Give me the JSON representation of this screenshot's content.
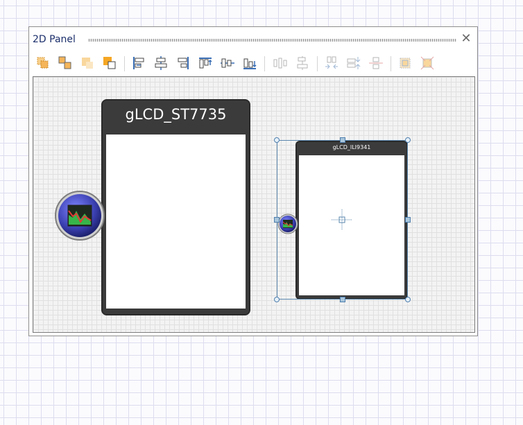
{
  "panel": {
    "title": "2D Panel",
    "close_symbol": "✕"
  },
  "toolbar": {
    "buttons": [
      {
        "name": "group-objects-icon",
        "enabled": true
      },
      {
        "name": "ungroup-objects-icon",
        "enabled": true
      },
      {
        "name": "send-backward-icon",
        "enabled": true
      },
      {
        "name": "bring-forward-icon",
        "enabled": true
      },
      {
        "name": "align-left-icon",
        "enabled": true
      },
      {
        "name": "align-center-icon",
        "enabled": true
      },
      {
        "name": "align-right-icon",
        "enabled": true
      },
      {
        "name": "align-top-icon",
        "enabled": true
      },
      {
        "name": "align-middle-icon",
        "enabled": true
      },
      {
        "name": "align-bottom-icon",
        "enabled": true
      },
      {
        "name": "distribute-horizontal-icon",
        "enabled": false
      },
      {
        "name": "distribute-vertical-icon",
        "enabled": false
      },
      {
        "name": "make-same-width-icon",
        "enabled": false
      },
      {
        "name": "make-same-height-icon",
        "enabled": false
      },
      {
        "name": "make-same-size-icon",
        "enabled": false
      },
      {
        "name": "fit-to-content-icon",
        "enabled": false
      },
      {
        "name": "reset-size-icon",
        "enabled": false
      }
    ]
  },
  "canvas": {
    "components": [
      {
        "title": "gLCD_ST7735",
        "icon": "chart-component-icon"
      },
      {
        "title": "gLCD_ILI9341",
        "icon": "chart-component-icon",
        "selected": true
      }
    ]
  },
  "colors": {
    "lcd_body": "#3b3b3b",
    "selection": "#5a86ad",
    "icon_orange": "#f5a623",
    "icon_blue": "#3b6fb6",
    "component_orb": "#3a3fb0"
  }
}
